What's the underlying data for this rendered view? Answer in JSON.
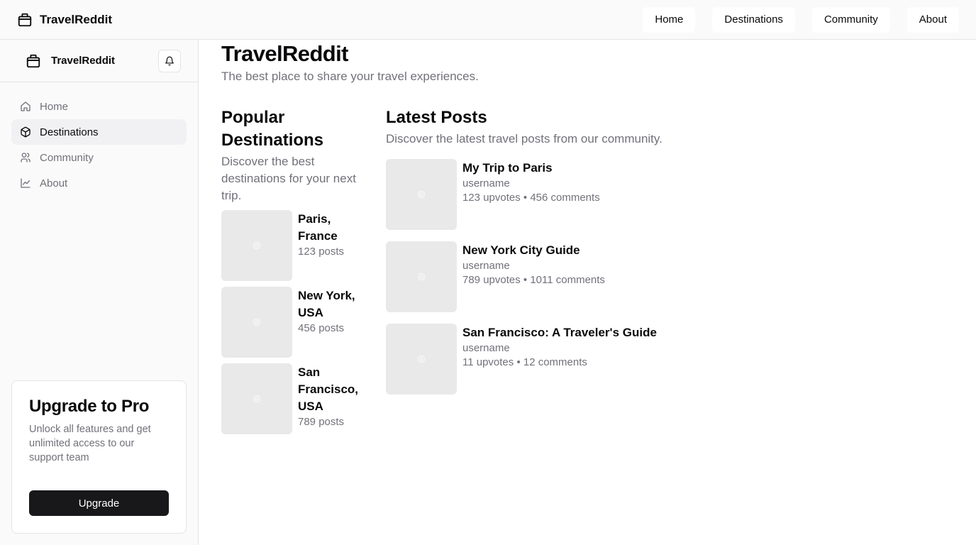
{
  "header": {
    "brand": "TravelReddit",
    "nav": [
      "Home",
      "Destinations",
      "Community",
      "About"
    ]
  },
  "sidebar": {
    "brand": "TravelReddit",
    "items": [
      {
        "label": "Home",
        "icon": "home-icon"
      },
      {
        "label": "Destinations",
        "icon": "package-icon",
        "active": true
      },
      {
        "label": "Community",
        "icon": "users-icon"
      },
      {
        "label": "About",
        "icon": "line-chart-icon"
      }
    ],
    "upgrade": {
      "title": "Upgrade to Pro",
      "description": "Unlock all features and get unlimited access to our support team",
      "button": "Upgrade"
    }
  },
  "main": {
    "title": "TravelReddit",
    "subtitle": "The best place to share your travel experiences.",
    "destinations": {
      "title": "Popular Destinations",
      "description": "Discover the best destinations for your next trip.",
      "items": [
        {
          "name": "Paris, France",
          "posts": "123 posts"
        },
        {
          "name": "New York, USA",
          "posts": "456 posts"
        },
        {
          "name": "San Francisco, USA",
          "posts": "789 posts"
        }
      ]
    },
    "posts": {
      "title": "Latest Posts",
      "description": "Discover the latest travel posts from our community.",
      "items": [
        {
          "title": "My Trip to Paris",
          "author": "username",
          "stats": "123 upvotes • 456 comments"
        },
        {
          "title": "New York City Guide",
          "author": "username",
          "stats": "789 upvotes • 1011 comments"
        },
        {
          "title": "San Francisco: A Traveler's Guide",
          "author": "username",
          "stats": "11 upvotes • 12 comments"
        }
      ]
    }
  },
  "colors": {
    "accent": "#18181b",
    "muted_text": "#71717a",
    "border": "#e4e4e7",
    "placeholder": "#e9e9e9"
  }
}
